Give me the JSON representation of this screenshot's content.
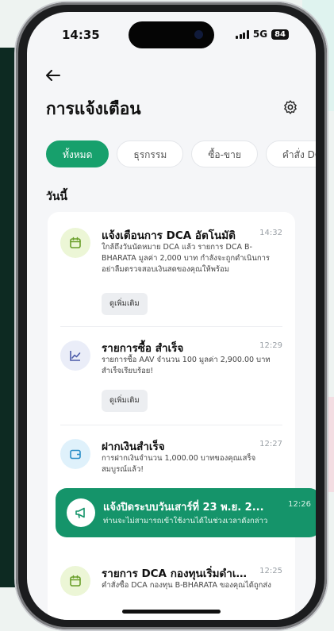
{
  "status": {
    "time": "14:35",
    "network": "5G",
    "battery": "84"
  },
  "header": {
    "title": "การแจ้งเตือน"
  },
  "icons": {
    "back": "arrow-left-icon",
    "settings": "gear-icon",
    "calendar": "calendar-icon",
    "chart": "chart-line-icon",
    "wallet": "wallet-icon",
    "megaphone": "megaphone-icon"
  },
  "colors": {
    "accent": "#17a06c",
    "highlight": "#15946a"
  },
  "filters": [
    "ทั้งหมด",
    "ธุรกรรม",
    "ซื้อ-ขาย",
    "คำสั่ง DCA"
  ],
  "section": "วันนี้",
  "notifications": [
    {
      "title": "แจ้งเตือนการ DCA อัตโนมัติ",
      "time": "14:32",
      "body": "ใกล้ถึงวันนัดหมาย DCA แล้ว รายการ DCA B-BHARATA มูลค่า 2,000 บาท กำลังจะถูกดำเนินการ อย่าลืมตรวจสอบเงินสดของคุณให้พร้อม",
      "more": "ดูเพิ่มเติม"
    },
    {
      "title": "รายการซื้อ สำเร็จ",
      "time": "12:29",
      "body": "รายการซื้อ AAV จำนวน 100 มูลค่า 2,900.00 บาท สำเร็จเรียบร้อย!",
      "more": "ดูเพิ่มเติม"
    },
    {
      "title": "ฝากเงินสำเร็จ",
      "time": "12:27",
      "body": "การฝากเงินจำนวน 1,000.00 บาทของคุณเสร็จสมบูรณ์แล้ว!"
    },
    {
      "title": "แจ้งปิดระบบวันเสาร์ที่ 23 พ.ย. 2...",
      "time": "12:26",
      "body": "ท่านจะไม่สามารถเข้าใช้งานได้ในช่วงเวลาดังกล่าว"
    },
    {
      "title": "รายการ DCA กองทุนเริ่มดำเนิน...",
      "time": "12:25",
      "body": "คำสั่งซื้อ DCA กองทุน B-BHARATA ของคุณได้ถูกส่ง"
    }
  ]
}
